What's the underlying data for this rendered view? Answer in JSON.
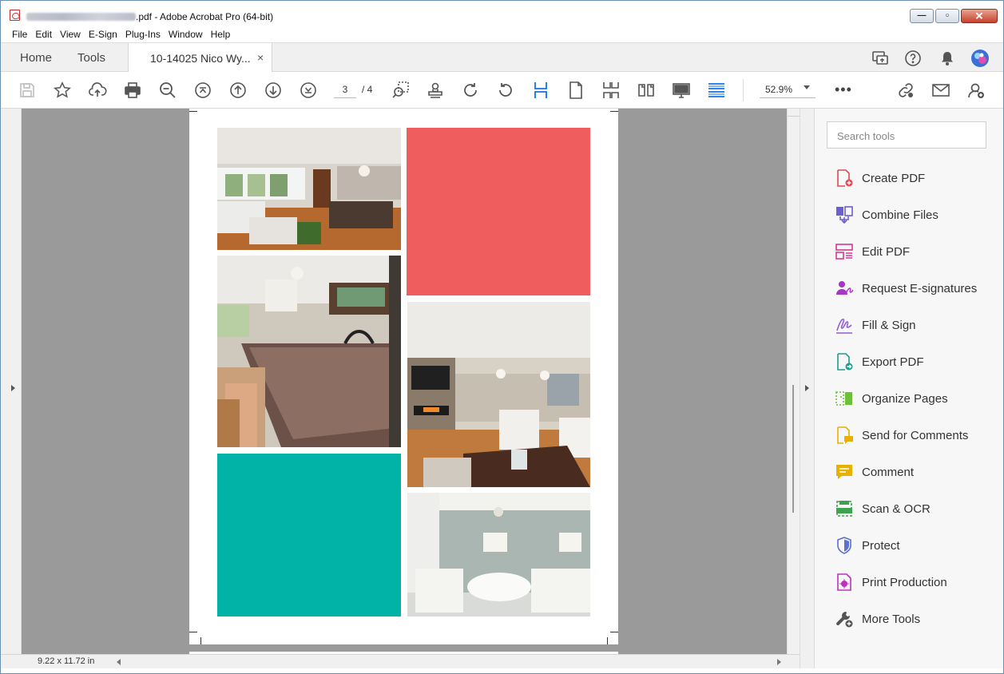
{
  "window": {
    "title_suffix": ".pdf - Adobe Acrobat Pro (64-bit)",
    "minimize_glyph": "—",
    "maximize_glyph": "▫",
    "close_glyph": "✕"
  },
  "menu": [
    "File",
    "Edit",
    "View",
    "E-Sign",
    "Plug-Ins",
    "Window",
    "Help"
  ],
  "tabs": {
    "home": "Home",
    "tools": "Tools",
    "document": "10-14025 Nico Wy...",
    "close_glyph": "×"
  },
  "toolbar": {
    "current_page": "3",
    "total_pages": "/  4",
    "zoom": "52.9%",
    "more": "•••"
  },
  "status": {
    "page_size": "9.22 x 11.72 in"
  },
  "tools_pane": {
    "search_placeholder": "Search tools",
    "items": [
      {
        "label": "Create PDF",
        "icon": "create-pdf-icon",
        "color": "#e34850"
      },
      {
        "label": "Combine Files",
        "icon": "combine-files-icon",
        "color": "#6b5dd3"
      },
      {
        "label": "Edit PDF",
        "icon": "edit-pdf-icon",
        "color": "#d83790"
      },
      {
        "label": "Request E-signatures",
        "icon": "request-esignatures-icon",
        "color": "#a636c8"
      },
      {
        "label": "Fill & Sign",
        "icon": "fill-sign-icon",
        "color": "#8f5fd6"
      },
      {
        "label": "Export PDF",
        "icon": "export-pdf-icon",
        "color": "#1d9e8e"
      },
      {
        "label": "Organize Pages",
        "icon": "organize-pages-icon",
        "color": "#6fbf3a"
      },
      {
        "label": "Send for Comments",
        "icon": "send-for-comments-icon",
        "color": "#e8b100"
      },
      {
        "label": "Comment",
        "icon": "comment-icon",
        "color": "#e8b100"
      },
      {
        "label": "Scan & OCR",
        "icon": "scan-ocr-icon",
        "color": "#3fa34d"
      },
      {
        "label": "Protect",
        "icon": "protect-icon",
        "color": "#5b6fd0"
      },
      {
        "label": "Print Production",
        "icon": "print-production-icon",
        "color": "#c030c0"
      },
      {
        "label": "More Tools",
        "icon": "more-tools-icon",
        "color": "#555555"
      }
    ]
  },
  "colors": {
    "accent": "#1473e6",
    "page_block_red": "#ef5d5e",
    "page_block_teal": "#00b3a6",
    "canvas_gray": "#9a9a9a"
  }
}
